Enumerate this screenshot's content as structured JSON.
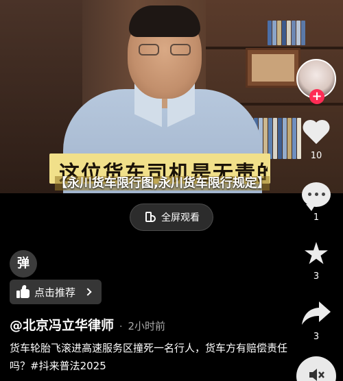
{
  "video": {
    "burned_subtitle": "这位货车司机是无责的",
    "title": "【永川货车限行图,永川货车限行规定】"
  },
  "fullscreen": {
    "label": "全屏观看",
    "icon": "fullscreen-phone-icon"
  },
  "rail": {
    "avatar": "author-avatar",
    "likes": "10",
    "comments": "1",
    "favorites": "3",
    "shares": "3"
  },
  "bottom": {
    "danmu_label": "弹",
    "recommend_label": "点击推荐",
    "author": "@北京冯立华律师",
    "separator": "·",
    "time": "2小时前",
    "description": "货车轮胎飞滚进高速服务区撞死一名行人，货车方有赔偿责任吗？#抖来普法2025"
  },
  "colors": {
    "background": "#000000",
    "follow_accent": "#fe2c55",
    "burned_subtitle_bg": "#f1e08a"
  }
}
